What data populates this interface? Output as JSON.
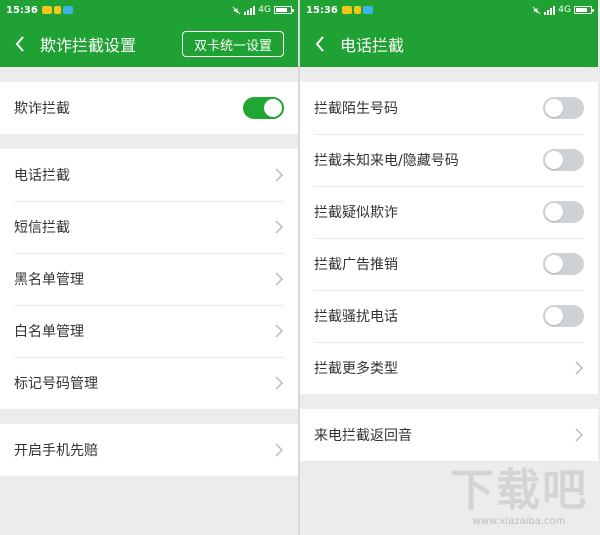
{
  "status_bar": {
    "time": "15:36",
    "network": "4G",
    "signal_label": "4G"
  },
  "left": {
    "title": "欺诈拦截设置",
    "header_button": "双卡统一设置",
    "main_toggle": {
      "label": "欺诈拦截",
      "on": true
    },
    "menu": [
      "电话拦截",
      "短信拦截",
      "黑名单管理",
      "白名单管理",
      "标记号码管理"
    ],
    "extra": "开启手机先赔"
  },
  "right": {
    "title": "电话拦截",
    "toggles": [
      {
        "label": "拦截陌生号码",
        "on": false
      },
      {
        "label": "拦截未知来电/隐藏号码",
        "on": false
      },
      {
        "label": "拦截疑似欺诈",
        "on": false
      },
      {
        "label": "拦截广告推销",
        "on": false
      },
      {
        "label": "拦截骚扰电话",
        "on": false
      }
    ],
    "more_types": "拦截更多类型",
    "return_tone": "来电拦截返回音"
  },
  "watermark": {
    "text": "下载吧",
    "url": "www.xiazaiba.com"
  },
  "colors": {
    "brand_green": "#1fa233",
    "toggle_on": "#20a634",
    "toggle_off": "#cfd2d4"
  }
}
